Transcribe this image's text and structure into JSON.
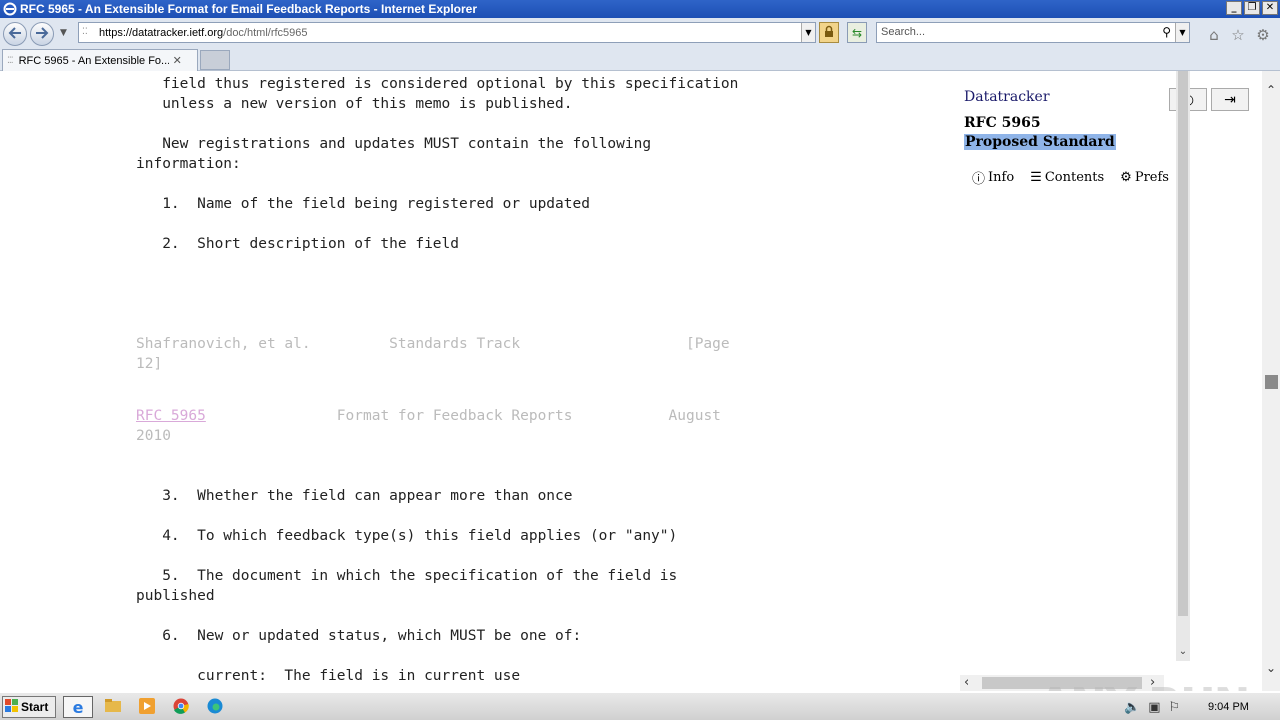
{
  "window": {
    "title": "RFC 5965 - An Extensible Format for Email Feedback Reports - Internet Explorer",
    "min": "_",
    "restore": "❐",
    "close": "✕"
  },
  "address": {
    "url_prefix": "https://datatracker.",
    "url_domain": "ietf.org",
    "url_path": "/doc/html/rfc5965"
  },
  "search": {
    "placeholder": "Search..."
  },
  "tab": {
    "label": "RFC 5965 - An Extensible Fo...",
    "close": "✕"
  },
  "doc": {
    "lines_top": "   field thus registered is considered optional by this specification\n   unless a new version of this memo is published.\n\n   New registrations and updates MUST contain the following\ninformation:\n\n   1.  Name of the field being registered or updated\n\n   2.  Short description of the field",
    "footer": "Shafranovich, et al.         Standards Track                   [Page\n12]",
    "header_link": "RFC 5965",
    "header_rest": "               Format for Feedback Reports           August\n2010",
    "lines_bottom": "   3.  Whether the field can appear more than once\n\n   4.  To which feedback type(s) this field applies (or \"any\")\n\n   5.  The document in which the specification of the field is\npublished\n\n   6.  New or updated status, which MUST be one of:\n\n       current:  The field is in current use"
  },
  "sidebar": {
    "datatracker": "Datatracker",
    "rfc": "RFC 5965",
    "status": "Proposed Standard",
    "info": "Info",
    "contents": "Contents",
    "prefs": "Prefs"
  },
  "watermark": "ANY RUN",
  "taskbar": {
    "start": "Start",
    "clock": "9:04 PM"
  }
}
